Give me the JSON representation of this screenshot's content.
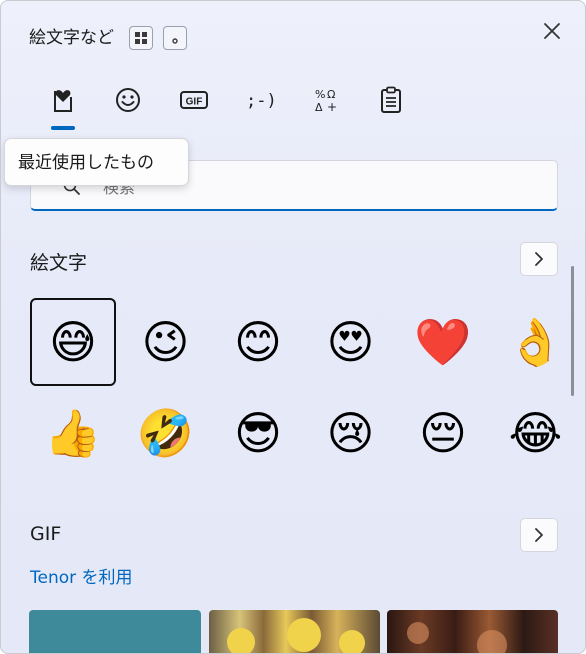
{
  "window": {
    "title": "絵文字など"
  },
  "tabs": [
    {
      "name": "tab-recent",
      "icon": "heart-clipboard-icon",
      "label": "最近使用したもの"
    },
    {
      "name": "tab-emoji",
      "icon": "smiley-icon"
    },
    {
      "name": "tab-gif",
      "icon": "gif-icon",
      "label": "GIF"
    },
    {
      "name": "tab-kaomoji",
      "icon": "kaomoji-icon",
      "label": ";-)"
    },
    {
      "name": "tab-symbols",
      "icon": "symbols-icon"
    },
    {
      "name": "tab-clipboard",
      "icon": "clipboard-icon"
    }
  ],
  "tooltip": {
    "text": "最近使用したもの"
  },
  "search": {
    "placeholder": "検索",
    "value": ""
  },
  "emoji_section": {
    "title": "絵文字",
    "items": [
      "😅",
      "😉",
      "😊",
      "😍",
      "❤️",
      "👌",
      "👍",
      "🤣",
      "😎",
      "😢",
      "😔",
      "😂"
    ],
    "selected_index": 0
  },
  "gif_section": {
    "title": "GIF",
    "link": "Tenor を利用"
  },
  "colors": {
    "accent": "#0067c0",
    "background": "#e7eaf8"
  }
}
